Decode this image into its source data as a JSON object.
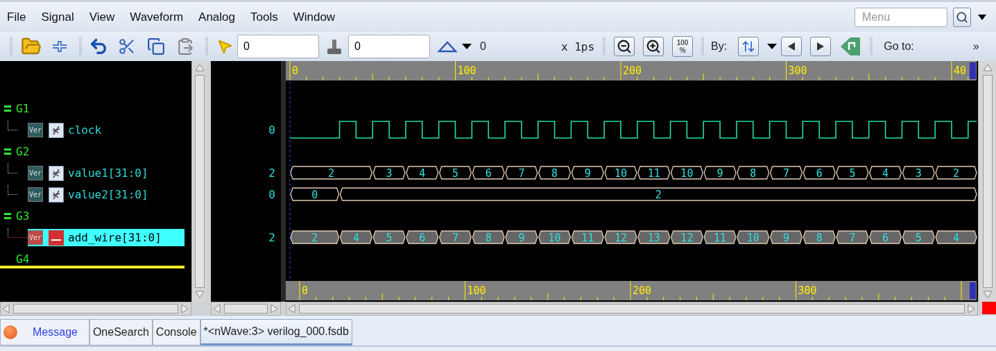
{
  "menu": [
    "File",
    "Signal",
    "View",
    "Waveform",
    "Analog",
    "Tools",
    "Window"
  ],
  "menu_search": {
    "placeholder": "Menu"
  },
  "toolbar": {
    "cursor_time": "0",
    "marker_time": "0",
    "delta": "0",
    "time_unit": "x 1ps",
    "fit_label": [
      "100",
      "%"
    ],
    "by_label": "By:",
    "goto_label": "Go to:",
    "more": "»"
  },
  "groups": [
    {
      "name": "G1",
      "expanded": true,
      "marker": false,
      "signals": [
        {
          "name": "clock",
          "badge": "Ver",
          "kind": "reg",
          "value": "0",
          "selected": false,
          "wave": {
            "kind": "clock"
          }
        }
      ]
    },
    {
      "name": "G2",
      "expanded": true,
      "marker": false,
      "signals": [
        {
          "name": "value1[31:0]",
          "badge": "Ver",
          "kind": "reg",
          "value": "2",
          "selected": false,
          "wave": {
            "kind": "bus",
            "segments": [
              {
                "value": "2",
                "wide": true
              },
              {
                "value": "3",
                "wide": false
              },
              {
                "value": "4",
                "wide": false
              },
              {
                "value": "5",
                "wide": false
              },
              {
                "value": "6",
                "wide": false
              },
              {
                "value": "7",
                "wide": false
              },
              {
                "value": "8",
                "wide": false
              },
              {
                "value": "9",
                "wide": false
              },
              {
                "value": "10",
                "wide": false
              },
              {
                "value": "11",
                "wide": false
              },
              {
                "value": "10",
                "wide": false
              },
              {
                "value": "9",
                "wide": false
              },
              {
                "value": "8",
                "wide": false
              },
              {
                "value": "7",
                "wide": false
              },
              {
                "value": "6",
                "wide": false
              },
              {
                "value": "5",
                "wide": false
              },
              {
                "value": "4",
                "wide": false
              },
              {
                "value": "3",
                "wide": false
              },
              {
                "value": "2",
                "wide": false
              }
            ]
          }
        },
        {
          "name": "value2[31:0]",
          "badge": "Ver",
          "kind": "reg",
          "value": "0",
          "selected": false,
          "wave": {
            "kind": "bus",
            "segments": [
              {
                "value": "0",
                "wide": false
              },
              {
                "value": "2",
                "wide": false
              }
            ]
          }
        }
      ]
    },
    {
      "name": "G3",
      "expanded": true,
      "marker": false,
      "signals": [
        {
          "name": "add_wire[31:0]",
          "badge": "Ver",
          "kind": "net",
          "value": "2",
          "selected": true,
          "wave": {
            "kind": "bus",
            "segments": [
              {
                "value": "2",
                "wide": false
              },
              {
                "value": "4",
                "wide": false
              },
              {
                "value": "5",
                "wide": false
              },
              {
                "value": "6",
                "wide": false
              },
              {
                "value": "7",
                "wide": false
              },
              {
                "value": "8",
                "wide": false
              },
              {
                "value": "9",
                "wide": false
              },
              {
                "value": "10",
                "wide": false
              },
              {
                "value": "11",
                "wide": false
              },
              {
                "value": "12",
                "wide": false
              },
              {
                "value": "13",
                "wide": false
              },
              {
                "value": "12",
                "wide": false
              },
              {
                "value": "11",
                "wide": false
              },
              {
                "value": "10",
                "wide": false
              },
              {
                "value": "9",
                "wide": false
              },
              {
                "value": "8",
                "wide": false
              },
              {
                "value": "7",
                "wide": false
              },
              {
                "value": "6",
                "wide": false
              },
              {
                "value": "5",
                "wide": false
              },
              {
                "value": "4",
                "wide": false
              }
            ]
          }
        }
      ]
    },
    {
      "name": "G4",
      "expanded": false,
      "marker": true
    }
  ],
  "ruler_top": {
    "labels": [
      "0",
      "100",
      "200",
      "300",
      "40"
    ]
  },
  "ruler_bottom": {
    "labels": [
      "0",
      "100",
      "200",
      "300"
    ]
  },
  "tabs": [
    {
      "label": "Message",
      "kind": "message",
      "selected": false
    },
    {
      "label": "OneSearch",
      "kind": "plain",
      "selected": false
    },
    {
      "label": "Console",
      "kind": "plain",
      "selected": false
    },
    {
      "label": "*<nWave:3> verilog_000.fsdb",
      "kind": "plain",
      "selected": true
    }
  ]
}
